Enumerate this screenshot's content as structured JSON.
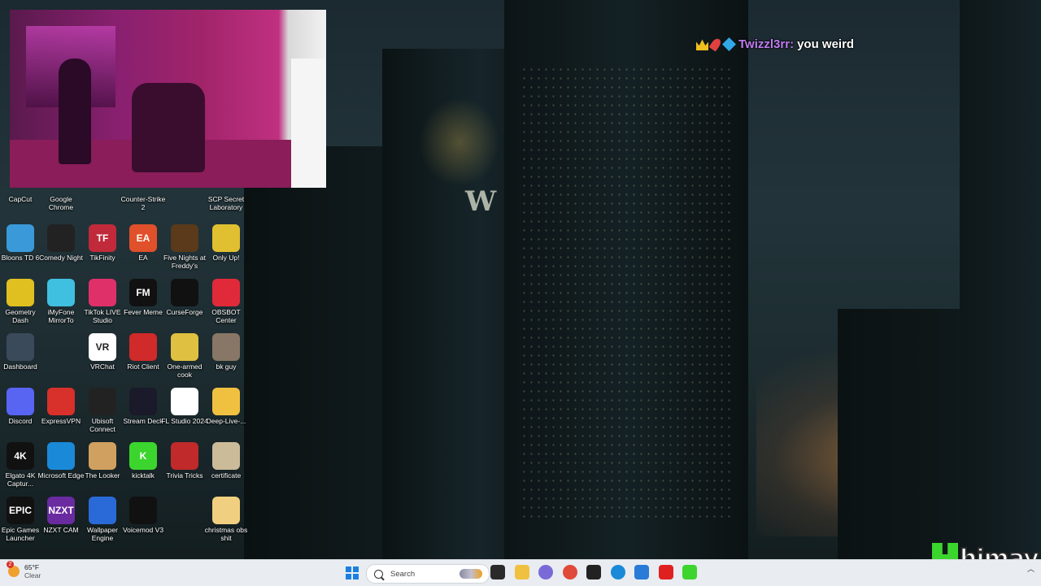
{
  "chat": {
    "username": "Twizzl3rr:",
    "message": "you weird"
  },
  "desktop_icons": [
    {
      "id": "capcut",
      "label": "CapCut",
      "color": "#222222",
      "glyph": ""
    },
    {
      "id": "google-chrome",
      "label": "Google Chrome",
      "color": "#ffffff",
      "glyph": ""
    },
    {
      "id": "counter-strike-2",
      "label": "Counter-Strike 2",
      "color": "#d89a20",
      "glyph": ""
    },
    {
      "id": "scp-secret-laboratory",
      "label": "SCP Secret Laboratory",
      "color": "#dddddd",
      "glyph": ""
    },
    {
      "id": "bloons-td-6",
      "label": "Bloons TD 6",
      "color": "#3a9ad9",
      "glyph": ""
    },
    {
      "id": "comedy-night",
      "label": "Comedy Night",
      "color": "#222222",
      "glyph": ""
    },
    {
      "id": "tikfinity",
      "label": "TikFinity",
      "color": "#c02a3a",
      "glyph": "TF"
    },
    {
      "id": "ea",
      "label": "EA",
      "color": "#e0502a",
      "glyph": "EA"
    },
    {
      "id": "five-nights-at-freddys",
      "label": "Five Nights at Freddy's",
      "color": "#5a3a1a",
      "glyph": ""
    },
    {
      "id": "only-up",
      "label": "Only Up!",
      "color": "#e0c030",
      "glyph": ""
    },
    {
      "id": "geometry-dash",
      "label": "Geometry Dash",
      "color": "#e0c020",
      "glyph": ""
    },
    {
      "id": "imyfone-mirrorto",
      "label": "iMyFone MirrorTo",
      "color": "#40c0e0",
      "glyph": ""
    },
    {
      "id": "tiktok-live-studio",
      "label": "TikTok LIVE Studio",
      "color": "#e0306a",
      "glyph": ""
    },
    {
      "id": "fever-meme",
      "label": "Fever Meme",
      "color": "#111111",
      "glyph": "FM"
    },
    {
      "id": "curseforge",
      "label": "CurseForge",
      "color": "#111111",
      "glyph": ""
    },
    {
      "id": "obsbot-center",
      "label": "OBSBOT Center",
      "color": "#e02a3a",
      "glyph": ""
    },
    {
      "id": "dashboard",
      "label": "Dashboard",
      "color": "#3a4a5a",
      "glyph": ""
    },
    {
      "id": "vrchat",
      "label": "VRChat",
      "color": "#ffffff",
      "glyph": "VR"
    },
    {
      "id": "riot-client",
      "label": "Riot Client",
      "color": "#d02a2a",
      "glyph": ""
    },
    {
      "id": "one-armed-cook",
      "label": "One-armed cook",
      "color": "#e0c040",
      "glyph": ""
    },
    {
      "id": "bk-guy",
      "label": "bk guy",
      "color": "#887766",
      "glyph": ""
    },
    {
      "id": "discord",
      "label": "Discord",
      "color": "#5865f2",
      "glyph": ""
    },
    {
      "id": "expressvpn",
      "label": "ExpressVPN",
      "color": "#d8302a",
      "glyph": ""
    },
    {
      "id": "ubisoft-connect",
      "label": "Ubisoft Connect",
      "color": "#222222",
      "glyph": ""
    },
    {
      "id": "stream-deck",
      "label": "Stream Deck",
      "color": "#1a1a2a",
      "glyph": ""
    },
    {
      "id": "fl-studio-2024",
      "label": "FL Studio 2024",
      "color": "#ffffff",
      "glyph": ""
    },
    {
      "id": "deep-live",
      "label": "Deep-Live-...",
      "color": "#f0c040",
      "glyph": ""
    },
    {
      "id": "elgato-4k-capture",
      "label": "Elgato 4K Captur...",
      "color": "#111111",
      "glyph": "4K"
    },
    {
      "id": "microsoft-edge",
      "label": "Microsoft Edge",
      "color": "#1a8ad8",
      "glyph": ""
    },
    {
      "id": "the-looker",
      "label": "The Looker",
      "color": "#d0a060",
      "glyph": ""
    },
    {
      "id": "kicktalk",
      "label": "kicktalk",
      "color": "#3cd52e",
      "glyph": "K"
    },
    {
      "id": "trivia-tricks",
      "label": "Trivia Tricks",
      "color": "#c02a2a",
      "glyph": ""
    },
    {
      "id": "certificate",
      "label": "certificate",
      "color": "#ccbb99",
      "glyph": ""
    },
    {
      "id": "epic-games-launcher",
      "label": "Epic Games Launcher",
      "color": "#111111",
      "glyph": "EPIC"
    },
    {
      "id": "nzxt-cam",
      "label": "NZXT CAM",
      "color": "#6a2aa0",
      "glyph": "NZXT"
    },
    {
      "id": "wallpaper-engine",
      "label": "Wallpaper Engine",
      "color": "#2a6ad8",
      "glyph": ""
    },
    {
      "id": "voicemod-v3",
      "label": "Voicemod V3",
      "color": "#111111",
      "glyph": ""
    },
    {
      "id": "christmas-obs-shit",
      "label": "christmas obs shit",
      "color": "#f0d080",
      "glyph": ""
    }
  ],
  "logo_text": "himay",
  "taskbar": {
    "weather_temp": "65°F",
    "weather_cond": "Clear",
    "weather_alert": "2",
    "search_placeholder": "Search",
    "apps": [
      {
        "name": "task-view",
        "color": "#2a2a2a"
      },
      {
        "name": "file-explorer",
        "color": "#f0c040"
      },
      {
        "name": "copilot",
        "color": "#7a6ad8"
      },
      {
        "name": "chrome",
        "color": "#e04a3a"
      },
      {
        "name": "obs",
        "color": "#222222"
      },
      {
        "name": "edge",
        "color": "#1a8ad8"
      },
      {
        "name": "store",
        "color": "#2a7ad8"
      },
      {
        "name": "youtube",
        "color": "#e02020"
      },
      {
        "name": "kick",
        "color": "#3cd52e"
      }
    ]
  }
}
